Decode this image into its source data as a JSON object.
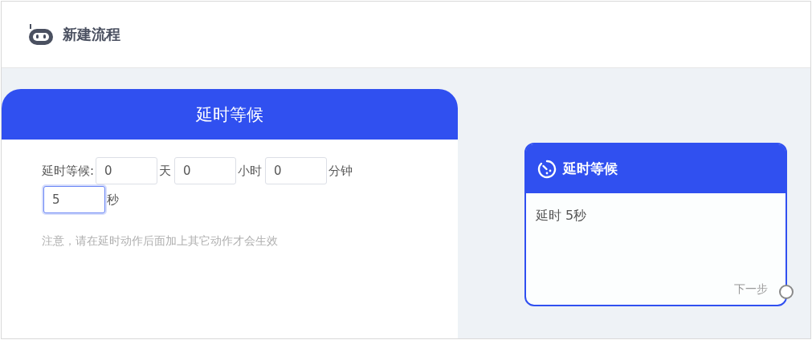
{
  "header": {
    "title": "新建流程"
  },
  "panel": {
    "title": "延时等候",
    "label": "延时等候:",
    "fields": [
      {
        "value": "0",
        "unit": "天",
        "focused": false
      },
      {
        "value": "0",
        "unit": "小时",
        "focused": false
      },
      {
        "value": "0",
        "unit": "分钟",
        "focused": false
      },
      {
        "value": "5",
        "unit": "秒",
        "focused": true
      }
    ],
    "note": "注意，请在延时动作后面加上其它动作才会生效"
  },
  "node": {
    "title": "延时等候",
    "text": "延时 5秒",
    "port_label": "下一步"
  }
}
